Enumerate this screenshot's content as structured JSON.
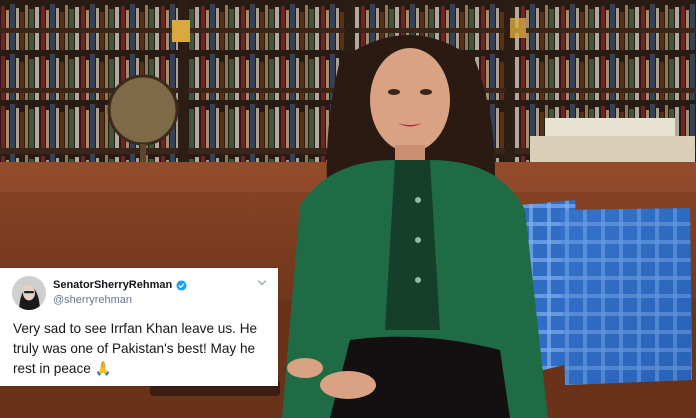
{
  "tweet": {
    "display_name": "SenatorSherryRehman",
    "handle": "@sherryrehman",
    "text": "Very sad to see Irrfan Khan leave us. He truly was one of Pakistan's best! May he rest in peace 🙏",
    "verified_icon": "verified-badge-icon",
    "menu_icon": "chevron-down-icon",
    "verified_color": "#1da1f2"
  },
  "photo": {
    "accent_jacket": "#1f6b45",
    "sofa_color": "#7a3a1e"
  }
}
